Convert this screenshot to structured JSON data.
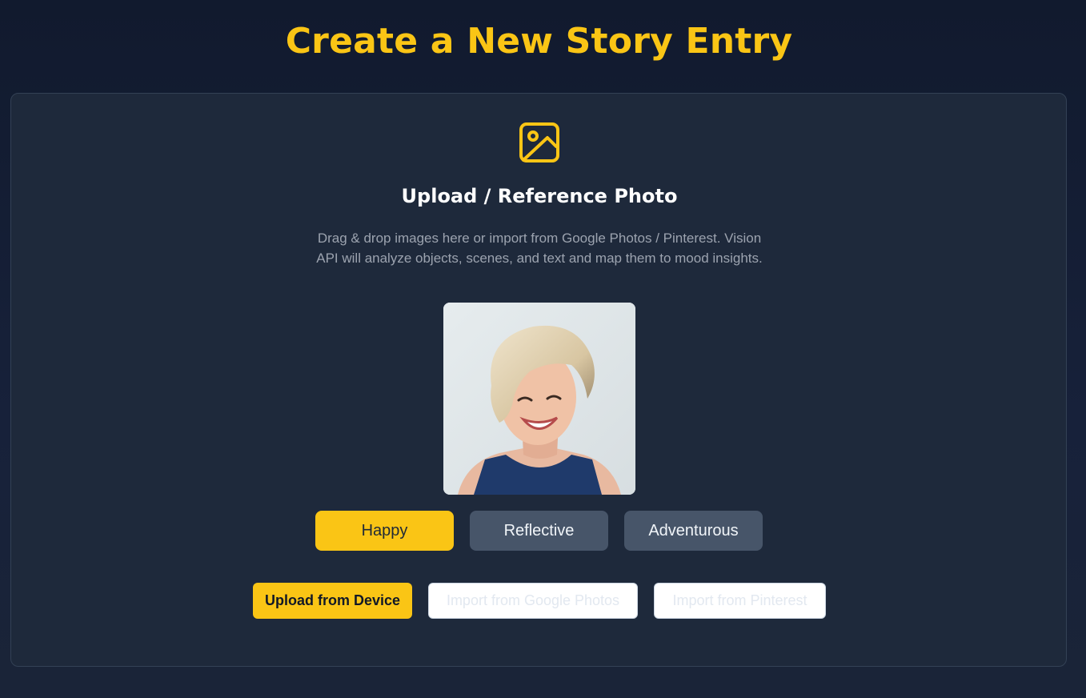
{
  "page": {
    "title": "Create a New Story Entry"
  },
  "upload": {
    "icon": "image-icon",
    "title": "Upload / Reference Photo",
    "description": "Drag & drop images here or import from Google Photos / Pinterest. Vision API will analyze objects, scenes, and text and map them to mood insights."
  },
  "moods": {
    "selected": "Happy",
    "items": [
      {
        "label": "Happy",
        "active": true
      },
      {
        "label": "Reflective",
        "active": false
      },
      {
        "label": "Adventurous",
        "active": false
      }
    ]
  },
  "actions": {
    "upload_device": "Upload from Device",
    "import_google": "Import from Google Photos",
    "import_pinterest": "Import from Pinterest"
  },
  "colors": {
    "accent": "#fac515",
    "background": "#111a2e",
    "card": "#1e293b",
    "mood_inactive": "#475569"
  }
}
